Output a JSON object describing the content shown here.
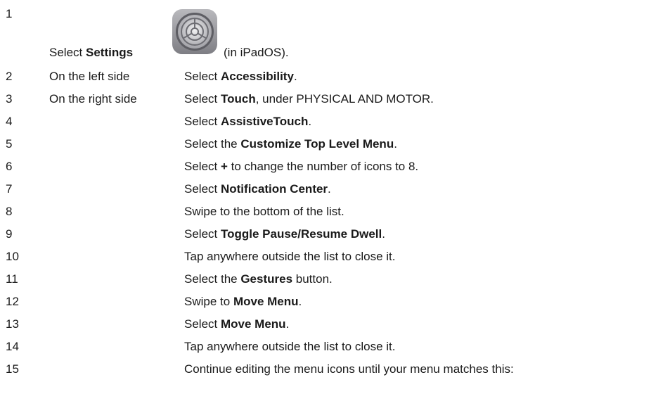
{
  "steps": [
    {
      "num": "1",
      "location": "",
      "parts": [
        {
          "t": "Select ",
          "b": false
        },
        {
          "t": "Settings",
          "b": true
        }
      ],
      "after_icon": "(in iPadOS).",
      "icon": "settings-gear-icon"
    },
    {
      "num": "2",
      "location": "On the left side",
      "parts": [
        {
          "t": "Select ",
          "b": false
        },
        {
          "t": "Accessibility",
          "b": true
        },
        {
          "t": ".",
          "b": false
        }
      ]
    },
    {
      "num": "3",
      "location": "On the right side",
      "parts": [
        {
          "t": "Select ",
          "b": false
        },
        {
          "t": "Touch",
          "b": true
        },
        {
          "t": ", under PHYSICAL AND MOTOR.",
          "b": false
        }
      ]
    },
    {
      "num": "4",
      "location": "",
      "parts": [
        {
          "t": "Select ",
          "b": false
        },
        {
          "t": "AssistiveTouch",
          "b": true
        },
        {
          "t": ".",
          "b": false
        }
      ]
    },
    {
      "num": "5",
      "location": "",
      "parts": [
        {
          "t": "Select the ",
          "b": false
        },
        {
          "t": "Customize Top Level Menu",
          "b": true
        },
        {
          "t": ".",
          "b": false
        }
      ]
    },
    {
      "num": "6",
      "location": "",
      "parts": [
        {
          "t": "Select ",
          "b": false
        },
        {
          "t": "+",
          "b": true
        },
        {
          "t": " to change the number of icons to 8.",
          "b": false
        }
      ]
    },
    {
      "num": "7",
      "location": "",
      "parts": [
        {
          "t": "Select ",
          "b": false
        },
        {
          "t": "Notification Center",
          "b": true
        },
        {
          "t": ".",
          "b": false
        }
      ]
    },
    {
      "num": "8",
      "location": "",
      "parts": [
        {
          "t": "Swipe to the bottom of the list.",
          "b": false
        }
      ]
    },
    {
      "num": "9",
      "location": "",
      "parts": [
        {
          "t": "Select ",
          "b": false
        },
        {
          "t": "Toggle Pause/Resume Dwell",
          "b": true
        },
        {
          "t": ".",
          "b": false
        }
      ]
    },
    {
      "num": "10",
      "location": "",
      "parts": [
        {
          "t": "Tap anywhere outside the list to close it.",
          "b": false
        }
      ]
    },
    {
      "num": "11",
      "location": "",
      "parts": [
        {
          "t": "Select the ",
          "b": false
        },
        {
          "t": "Gestures",
          "b": true
        },
        {
          "t": " button.",
          "b": false
        }
      ]
    },
    {
      "num": "12",
      "location": "",
      "parts": [
        {
          "t": "Swipe to ",
          "b": false
        },
        {
          "t": "Move Menu",
          "b": true
        },
        {
          "t": ".",
          "b": false
        }
      ]
    },
    {
      "num": "13",
      "location": "",
      "parts": [
        {
          "t": "Select ",
          "b": false
        },
        {
          "t": "Move Menu",
          "b": true
        },
        {
          "t": ".",
          "b": false
        }
      ]
    },
    {
      "num": "14",
      "location": "",
      "parts": [
        {
          "t": "Tap anywhere outside the list to close it.",
          "b": false
        }
      ]
    },
    {
      "num": "15",
      "location": "",
      "parts": [
        {
          "t": "Continue editing the menu icons until your menu matches this:",
          "b": false
        }
      ]
    }
  ]
}
